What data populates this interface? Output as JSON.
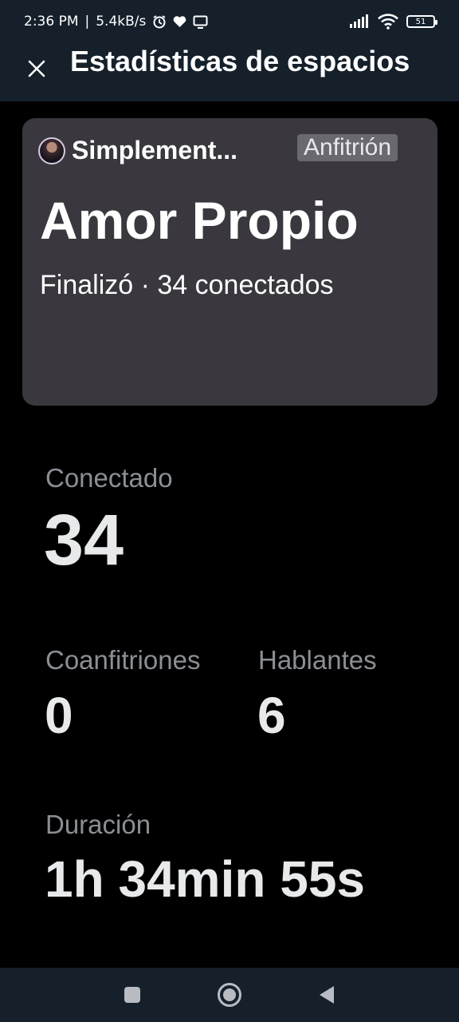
{
  "status_bar": {
    "time": "2:36 PM",
    "net_speed": "5.4kB/s",
    "battery": "51",
    "icons": [
      "alarm-icon",
      "heart-icon",
      "screen-icon",
      "signal-icon",
      "wifi-icon",
      "battery-icon"
    ]
  },
  "header": {
    "close_icon": "close-icon",
    "title": "Estadísticas de espacios"
  },
  "card": {
    "host_name": "Simplement...",
    "host_badge": "Anfitrión",
    "title": "Amor Propio",
    "subtitle": "Finalizó · 34 conectados"
  },
  "stats": {
    "connected_label": "Conectado",
    "connected_value": "34",
    "cohosts_label": "Coanfitriones",
    "cohosts_value": "0",
    "speakers_label": "Hablantes",
    "speakers_value": "6",
    "duration_label": "Duración",
    "duration_value": "1h 34min 55s"
  },
  "nav": {
    "buttons": [
      "recents-icon",
      "home-icon",
      "back-icon"
    ]
  },
  "colors": {
    "bar_bg": "#15202b",
    "card_bg": "#3a383e",
    "label_gray": "#8b8f94"
  }
}
